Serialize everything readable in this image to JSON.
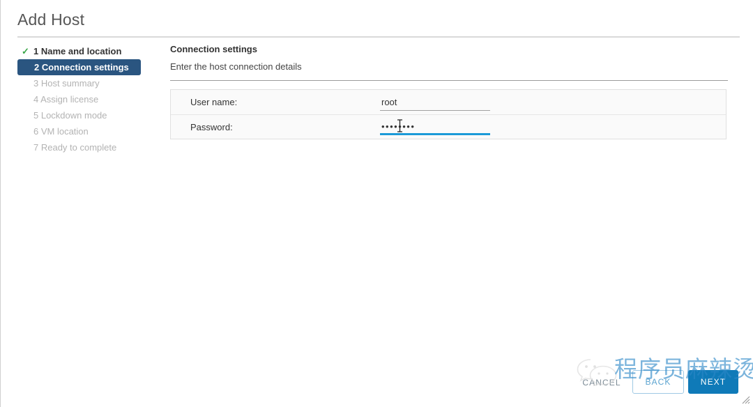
{
  "window": {
    "title": "Add Host"
  },
  "steps": [
    {
      "number": "1",
      "label": "1 Name and location",
      "state": "done",
      "icon": "check-icon"
    },
    {
      "number": "2",
      "label": "2 Connection settings",
      "state": "active",
      "icon": ""
    },
    {
      "number": "3",
      "label": "3 Host summary",
      "state": "pending",
      "icon": ""
    },
    {
      "number": "4",
      "label": "4 Assign license",
      "state": "pending",
      "icon": ""
    },
    {
      "number": "5",
      "label": "5 Lockdown mode",
      "state": "pending",
      "icon": ""
    },
    {
      "number": "6",
      "label": "6 VM location",
      "state": "pending",
      "icon": ""
    },
    {
      "number": "7",
      "label": "7 Ready to complete",
      "state": "pending",
      "icon": ""
    }
  ],
  "content": {
    "title": "Connection settings",
    "subtitle": "Enter the host connection details",
    "fields": [
      {
        "label": "User name:",
        "value": "root",
        "type": "text",
        "focused": false
      },
      {
        "label": "Password:",
        "value": "••••••••",
        "type": "password",
        "focused": true
      }
    ]
  },
  "footer": {
    "cancel_label": "CANCEL",
    "back_label": "BACK",
    "next_label": "NEXT"
  },
  "watermark": {
    "text": "程序员麻辣烫",
    "logo": "wechat-logo"
  },
  "colors": {
    "active_step_bg": "#2a5580",
    "check_green": "#3aa648",
    "primary_button": "#0f7ab8",
    "focus_underline": "#1b9ad8",
    "watermark_blue": "#2b87c8"
  }
}
